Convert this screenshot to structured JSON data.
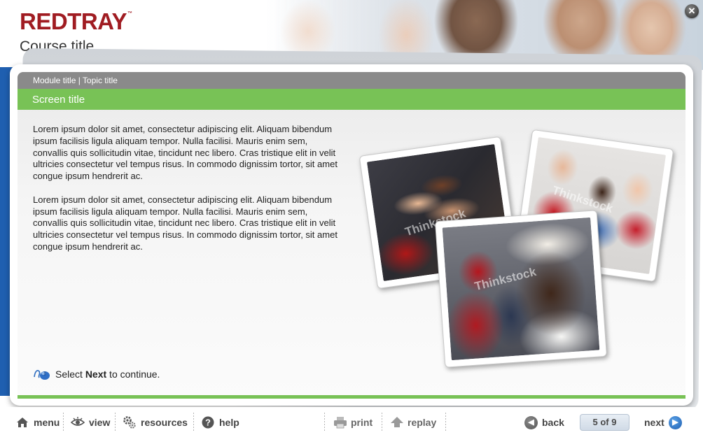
{
  "header": {
    "brand": "REDTRAY",
    "brand_tm": "™",
    "course_title": "Course title"
  },
  "breadcrumb": "Module title | Topic title",
  "screen_title": "Screen title",
  "body_paragraphs": [
    "Lorem ipsum dolor sit amet, consectetur adipiscing elit. Aliquam bibendum ipsum facilisis ligula aliquam tempor. Nulla facilisi. Mauris enim sem, convallis quis sollicitudin vitae, tincidunt nec libero. Cras tristique elit in velit ultricies consectetur vel tempus risus. In commodo dignissim tortor, sit amet congue ipsum hendrerit ac.",
    "Lorem ipsum dolor sit amet, consectetur adipiscing elit. Aliquam bibendum ipsum facilisis ligula aliquam tempor. Nulla facilisi. Mauris enim sem, convallis quis sollicitudin vitae, tincidunt nec libero. Cras tristique elit in velit ultricies consectetur vel tempus risus. In commodo dignissim tortor, sit amet congue ipsum hendrerit ac."
  ],
  "prompt": {
    "before": "Select ",
    "bold": "Next",
    "after": " to continue."
  },
  "photos": {
    "watermark": "Thinkstock"
  },
  "footer": {
    "menu": "menu",
    "view": "view",
    "resources": "resources",
    "help": "help",
    "print": "print",
    "replay": "replay",
    "back": "back",
    "page_indicator": "5 of 9",
    "next": "next"
  },
  "colors": {
    "brand_red": "#a01c22",
    "accent_green": "#78c256",
    "breadcrumb_gray": "#8a8a8a",
    "accent_blue": "#1f5fb0"
  },
  "icons": {
    "close": "close-icon",
    "menu": "home-icon",
    "view": "eye-icon",
    "resources": "gears-icon",
    "help": "question-icon",
    "print": "printer-icon",
    "replay": "replay-arrow-icon",
    "back": "back-arrow-icon",
    "next": "next-arrow-icon",
    "prompt": "mouse-click-icon"
  }
}
